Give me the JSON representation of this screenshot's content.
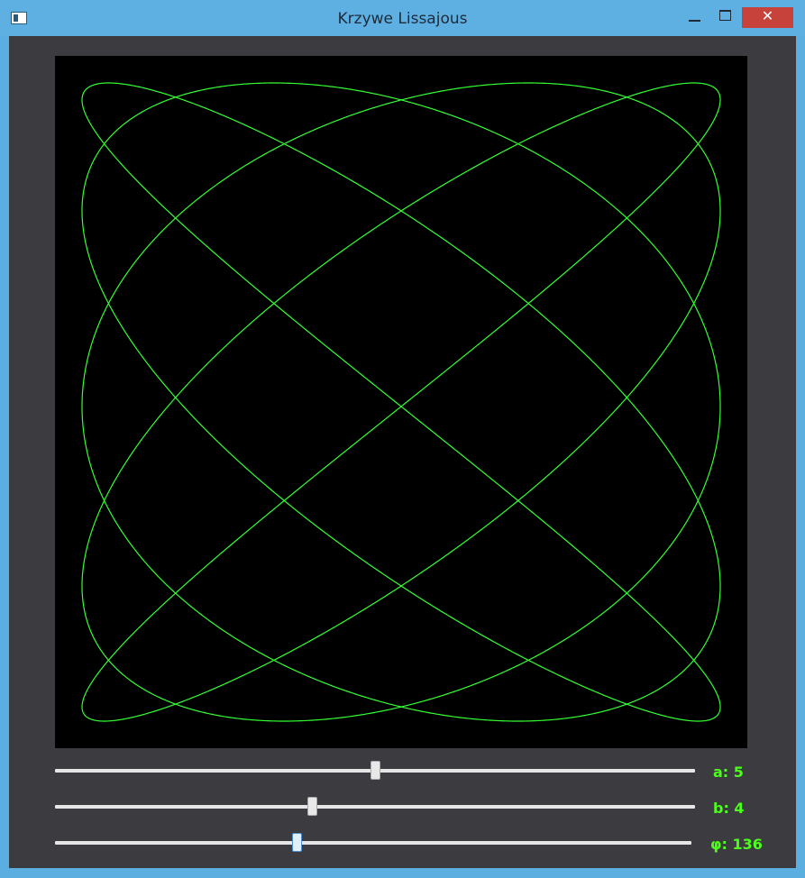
{
  "window": {
    "title": "Krzywe Lissajous",
    "icon": "app-window-icon",
    "controls": {
      "minimize": "minimize-icon",
      "maximize": "maximize-icon",
      "close": "✕"
    }
  },
  "colors": {
    "titlebar": "#5fb0e2",
    "client_background": "#3c3c40",
    "canvas_background": "#000000",
    "curve": "#33ff33",
    "label": "#4cff1a",
    "close_button": "#c8423c"
  },
  "curve": {
    "a": 5,
    "b": 4,
    "phi_degrees": 136
  },
  "sliders": [
    {
      "name": "a",
      "label": "a: 5",
      "fraction": 0.5
    },
    {
      "name": "b",
      "label": "b: 4",
      "fraction": 0.4
    },
    {
      "name": "phi",
      "label": "φ: 136",
      "fraction": 0.378
    }
  ]
}
